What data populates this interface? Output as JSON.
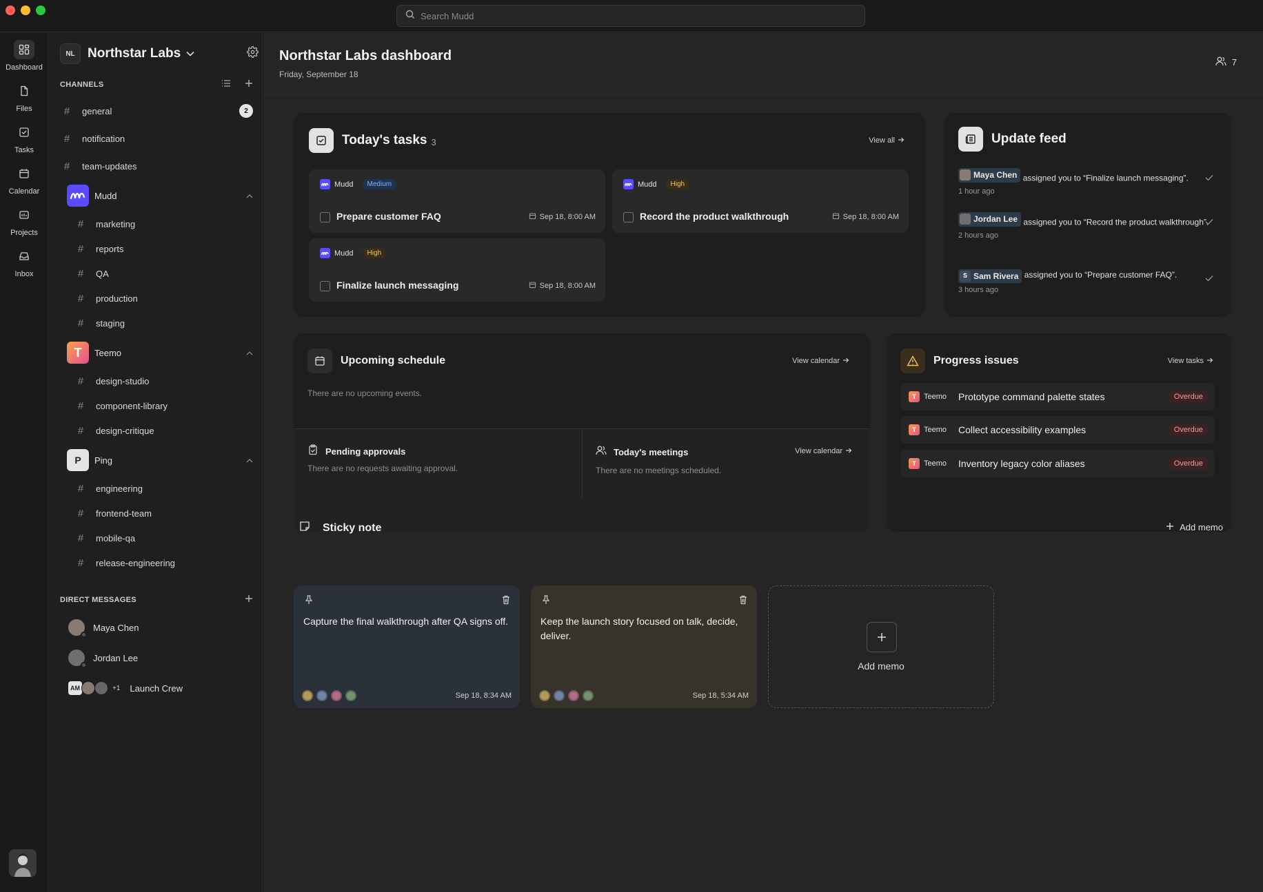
{
  "search": {
    "placeholder": "Search Mudd"
  },
  "rail": {
    "items": [
      {
        "label": "Dashboard",
        "icon": "dashboard-icon"
      },
      {
        "label": "Files",
        "icon": "file-icon"
      },
      {
        "label": "Tasks",
        "icon": "check-square-icon"
      },
      {
        "label": "Calendar",
        "icon": "calendar-icon"
      },
      {
        "label": "Projects",
        "icon": "folder-icon"
      },
      {
        "label": "Inbox",
        "icon": "inbox-icon"
      }
    ]
  },
  "workspace": {
    "initials": "NL",
    "name": "Northstar Labs"
  },
  "channels": {
    "title": "CHANNELS",
    "top": [
      {
        "name": "general",
        "badge": "2"
      },
      {
        "name": "notification"
      },
      {
        "name": "team-updates"
      }
    ],
    "groups": [
      {
        "name": "Mudd",
        "channels": [
          "marketing",
          "reports",
          "QA",
          "production",
          "staging"
        ]
      },
      {
        "name": "Teemo",
        "logo_letter": "T",
        "channels": [
          "design-studio",
          "component-library",
          "design-critique"
        ]
      },
      {
        "name": "Ping",
        "logo_letter": "P",
        "channels": [
          "engineering",
          "frontend-team",
          "mobile-qa",
          "release-engineering"
        ]
      }
    ]
  },
  "direct_messages": {
    "title": "DIRECT MESSAGES",
    "items": [
      {
        "name": "Maya Chen"
      },
      {
        "name": "Jordan Lee"
      },
      {
        "name": "Launch Crew",
        "avatar_initials": "AM",
        "extra": "+1"
      }
    ]
  },
  "header": {
    "title": "Northstar Labs dashboard",
    "date": "Friday, September 18",
    "member_count": "7"
  },
  "tasks": {
    "title": "Today's tasks",
    "count": "3",
    "view_all": "View all",
    "items": [
      {
        "source": "Mudd",
        "priority": "Medium",
        "name": "Prepare customer FAQ",
        "due": "Sep 18, 8:00 AM"
      },
      {
        "source": "Mudd",
        "priority": "High",
        "name": "Record the product walkthrough",
        "due": "Sep 18, 8:00 AM"
      },
      {
        "source": "Mudd",
        "priority": "High",
        "name": "Finalize launch messaging",
        "due": "Sep 18, 8:00 AM"
      }
    ]
  },
  "feed": {
    "title": "Update feed",
    "items": [
      {
        "user": "Maya Chen",
        "text": "assigned you to “Finalize launch messaging”.",
        "time": "1 hour ago"
      },
      {
        "user": "Jordan Lee",
        "text": "assigned you to “Record the product walkthrough”.",
        "time": "2 hours ago"
      },
      {
        "user": "Sam Rivera",
        "initial": "S",
        "text": "assigned you to “Prepare customer FAQ”.",
        "time": "3 hours ago"
      }
    ]
  },
  "schedule": {
    "title": "Upcoming schedule",
    "link": "View calendar",
    "empty": "There are no upcoming events."
  },
  "approvals": {
    "title": "Pending approvals",
    "empty": "There are no requests awaiting approval."
  },
  "meetings": {
    "title": "Today's meetings",
    "link": "View calendar",
    "empty": "There are no meetings scheduled."
  },
  "issues": {
    "title": "Progress issues",
    "link": "View tasks",
    "items": [
      {
        "source": "Teemo",
        "name": "Prototype command palette states",
        "status": "Overdue"
      },
      {
        "source": "Teemo",
        "name": "Collect accessibility examples",
        "status": "Overdue"
      },
      {
        "source": "Teemo",
        "name": "Inventory legacy color aliases",
        "status": "Overdue"
      }
    ]
  },
  "sticky": {
    "title": "Sticky note",
    "add_label": "Add memo",
    "memos": [
      {
        "text": "Capture the final walkthrough after QA signs off.",
        "time": "Sep 18, 8:34 AM",
        "color": "#2a313b"
      },
      {
        "text": "Keep the launch story focused on talk, decide, deliver.",
        "time": "Sep 18, 5:34 AM",
        "color": "#37332a"
      }
    ],
    "add_card_label": "Add memo"
  },
  "colors": {
    "accent": "#5b4bff",
    "overdue": "#f39a9a",
    "medium": "#7fb3ff",
    "high": "#f0c36a"
  }
}
